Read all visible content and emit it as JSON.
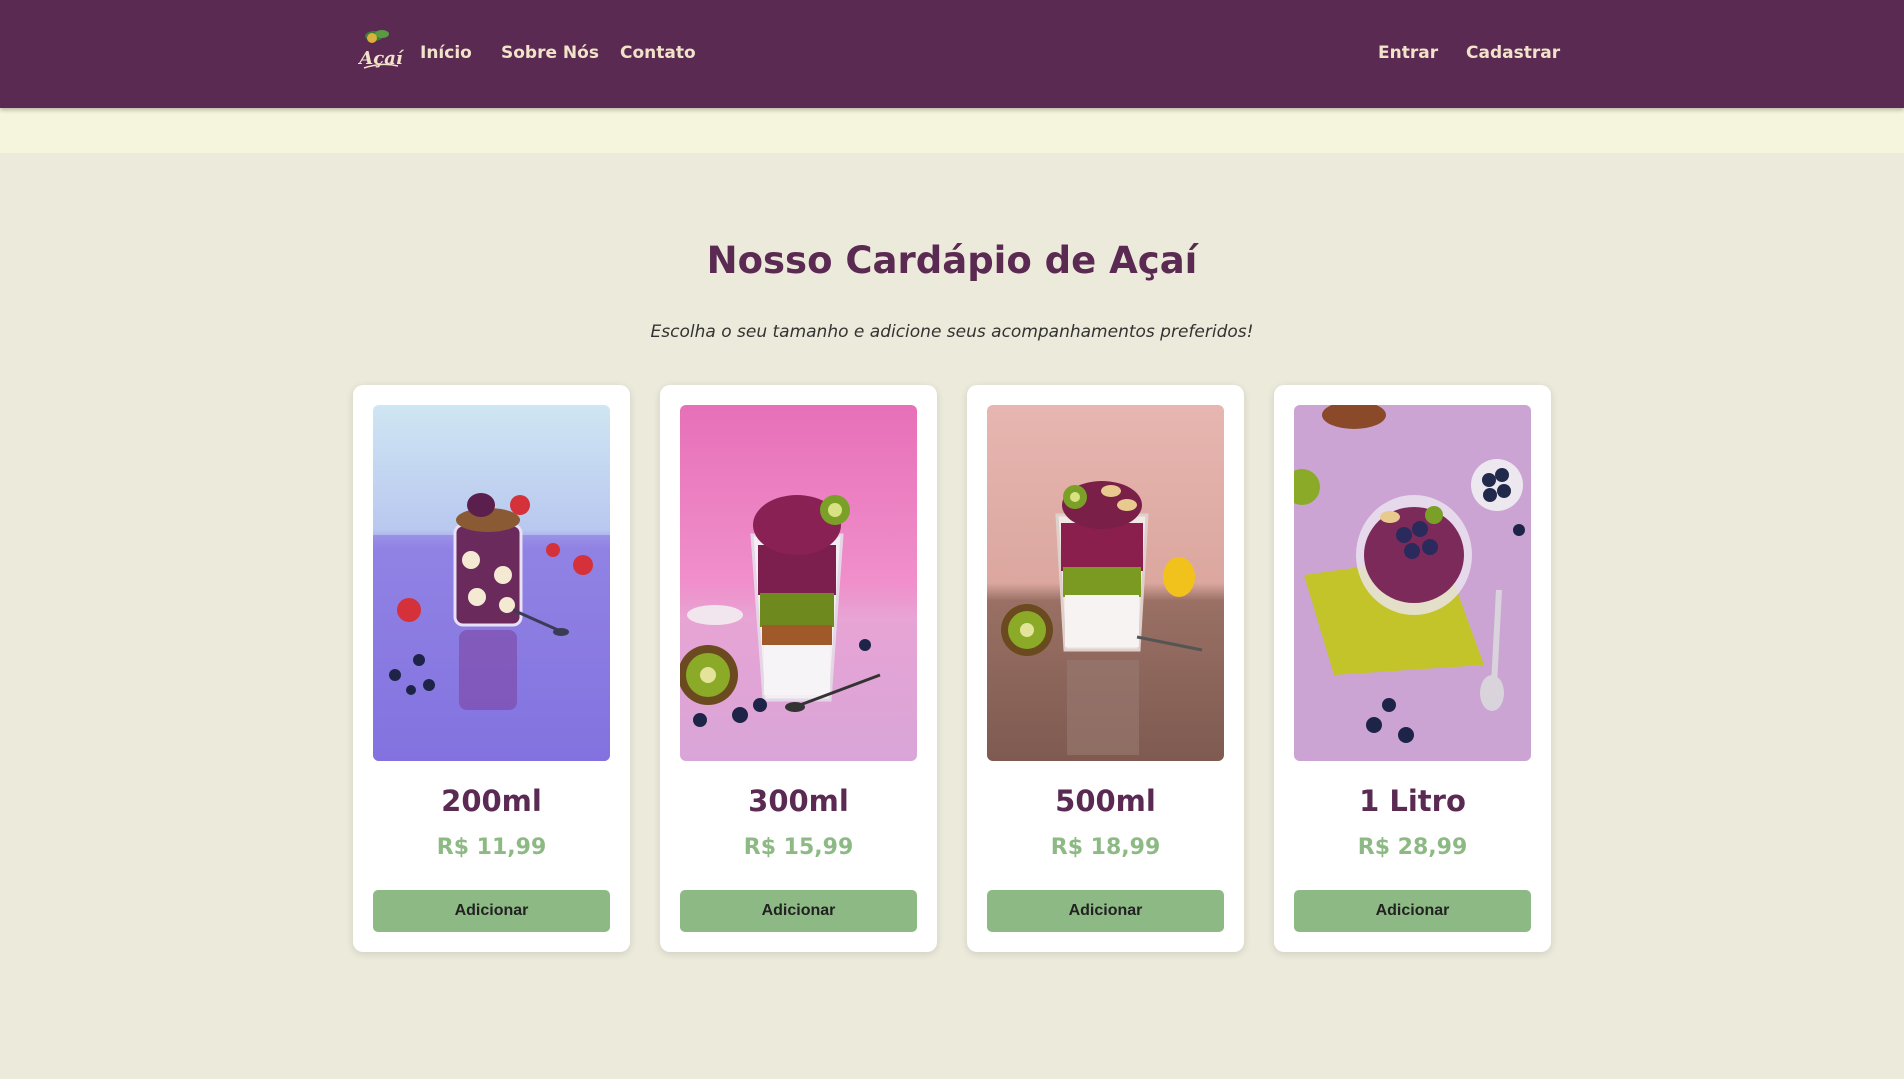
{
  "navbar": {
    "logo_text": "Açaí",
    "links": [
      "Início",
      "Sobre Nós",
      "Contato"
    ],
    "auth": {
      "login": "Entrar",
      "signup": "Cadastrar"
    }
  },
  "menu": {
    "title": "Nosso Cardápio de Açaí",
    "subtitle": "Escolha o seu tamanho e adicione seus acompanhamentos preferidos!",
    "products": [
      {
        "size": "200ml",
        "price": "R$ 11,99",
        "button": "Adicionar"
      },
      {
        "size": "300ml",
        "price": "R$ 15,99",
        "button": "Adicionar"
      },
      {
        "size": "500ml",
        "price": "R$ 18,99",
        "button": "Adicionar"
      },
      {
        "size": "1 Litro",
        "price": "R$ 28,99",
        "button": "Adicionar"
      }
    ]
  },
  "colors": {
    "navbar_bg": "#5a2a52",
    "nav_text": "#f1e3c9",
    "page_bg": "#eceada",
    "title": "#5a2a52",
    "price": "#8dba84",
    "button_bg": "#8dba84"
  }
}
